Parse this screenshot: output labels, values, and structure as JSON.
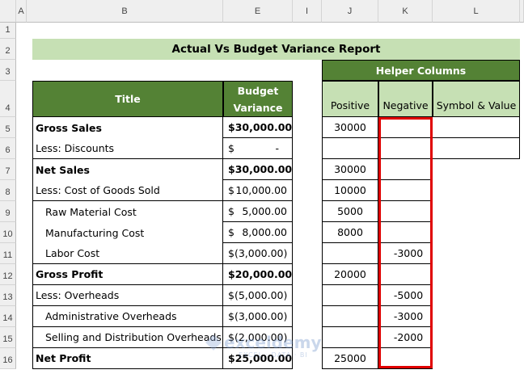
{
  "columns": [
    "A",
    "B",
    "E",
    "I",
    "J",
    "K",
    "L"
  ],
  "rows": [
    "1",
    "2",
    "3",
    "4",
    "5",
    "6",
    "7",
    "8",
    "9",
    "10",
    "11",
    "12",
    "13",
    "14",
    "15",
    "16"
  ],
  "report_title": "Actual Vs Budget Variance Report",
  "helper_title": "Helper Columns",
  "headers": {
    "title": "Title",
    "variance_line1": "Budget",
    "variance_line2": "Variance",
    "positive": "Positive",
    "negative": "Negative",
    "symbol": "Symbol & Value"
  },
  "table": [
    {
      "title": "Gross Sales",
      "bold": true,
      "indent": false,
      "cur": "$",
      "amt": "30,000.00",
      "pos": "30000",
      "neg": ""
    },
    {
      "title": "Less: Discounts",
      "bold": false,
      "indent": false,
      "cur": "$",
      "amt": "-",
      "pos": "",
      "neg": ""
    },
    {
      "title": "Net Sales",
      "bold": true,
      "indent": false,
      "cur": "$",
      "amt": "30,000.00",
      "pos": "30000",
      "neg": ""
    },
    {
      "title": "Less: Cost of Goods Sold",
      "bold": false,
      "indent": false,
      "cur": "$",
      "amt": "10,000.00",
      "pos": "10000",
      "neg": ""
    },
    {
      "title": "Raw Material Cost",
      "bold": false,
      "indent": true,
      "cur": "$",
      "amt": "5,000.00",
      "pos": "5000",
      "neg": ""
    },
    {
      "title": "Manufacturing Cost",
      "bold": false,
      "indent": true,
      "cur": "$",
      "amt": "8,000.00",
      "pos": "8000",
      "neg": ""
    },
    {
      "title": "Labor Cost",
      "bold": false,
      "indent": true,
      "cur": "$",
      "amt": "(3,000.00)",
      "pos": "",
      "neg": "-3000"
    },
    {
      "title": "Gross Profit",
      "bold": true,
      "indent": false,
      "cur": "$",
      "amt": "20,000.00",
      "pos": "20000",
      "neg": ""
    },
    {
      "title": "Less: Overheads",
      "bold": false,
      "indent": false,
      "cur": "$",
      "amt": "(5,000.00)",
      "pos": "",
      "neg": "-5000"
    },
    {
      "title": "Administrative Overheads",
      "bold": false,
      "indent": true,
      "cur": "$",
      "amt": "(3,000.00)",
      "pos": "",
      "neg": "-3000"
    },
    {
      "title": "Selling and Distribution Overheads",
      "bold": false,
      "indent": true,
      "cur": "$",
      "amt": "(2,000.00)",
      "pos": "",
      "neg": "-2000"
    },
    {
      "title": "Net Profit",
      "bold": true,
      "indent": false,
      "cur": "$",
      "amt": "25,000.00",
      "pos": "25000",
      "neg": ""
    }
  ],
  "watermark": {
    "name": "exceldemy",
    "tagline": "EXCEL · DATA · BI"
  },
  "colors": {
    "header_green": "#548235",
    "light_green": "#c6e0b4",
    "selection_red": "#e00000"
  }
}
